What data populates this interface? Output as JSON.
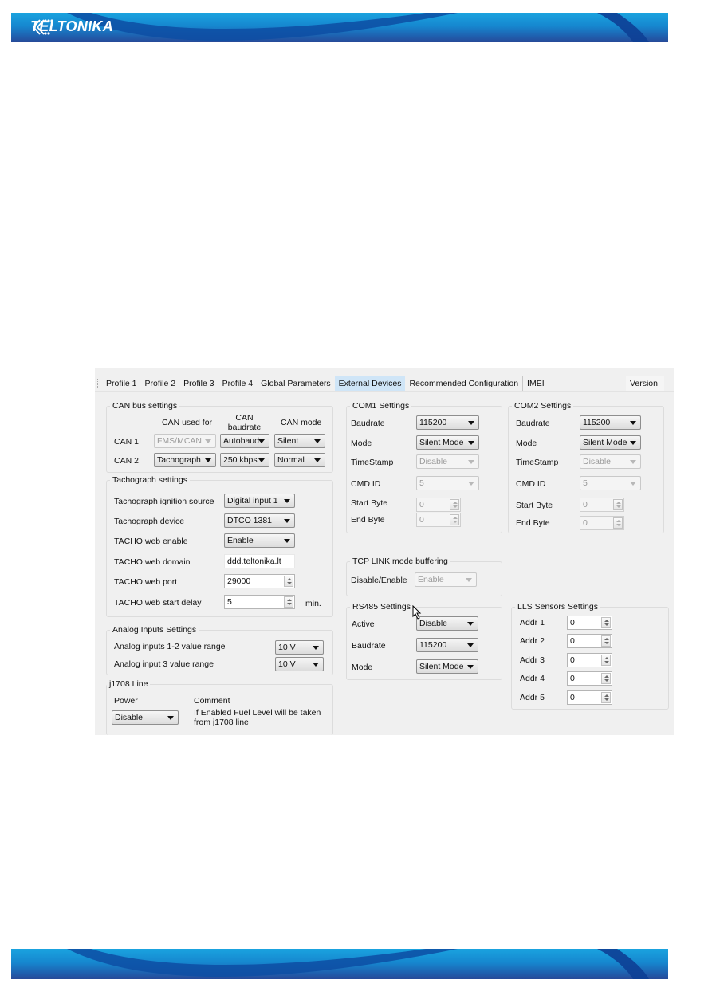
{
  "header": {
    "brand": "TELTONIKA"
  },
  "app": {
    "tabs": [
      {
        "label": "Profile 1"
      },
      {
        "label": "Profile 2"
      },
      {
        "label": "Profile 3"
      },
      {
        "label": "Profile 4"
      },
      {
        "label": "Global Parameters"
      },
      {
        "label": "External Devices",
        "active": true
      },
      {
        "label": "Recommended Configuration"
      },
      {
        "label": "IMEI"
      },
      {
        "label": "Version"
      }
    ],
    "can": {
      "title": "CAN bus settings",
      "col_used_for": "CAN used for",
      "col_baudrate": "CAN baudrate",
      "col_mode": "CAN mode",
      "rows": [
        {
          "label": "CAN 1",
          "used_for": "FMS/MCAN",
          "baudrate": "Autobaud",
          "mode": "Silent"
        },
        {
          "label": "CAN 2",
          "used_for": "Tachograph",
          "baudrate": "250 kbps",
          "mode": "Normal"
        }
      ]
    },
    "tacho": {
      "title": "Tachograph settings",
      "ignition_label": "Tachograph ignition source",
      "ignition_value": "Digital input 1",
      "device_label": "Tachograph device",
      "device_value": "DTCO 1381",
      "web_enable_label": "TACHO web enable",
      "web_enable_value": "Enable",
      "web_domain_label": "TACHO web domain",
      "web_domain_value": "ddd.teltonika.lt",
      "web_port_label": "TACHO web port",
      "web_port_value": "29000",
      "start_delay_label": "TACHO web start delay",
      "start_delay_value": "5",
      "start_delay_unit": "min."
    },
    "analog": {
      "title": "Analog Inputs Settings",
      "in12_label": "Analog inputs 1-2 value range",
      "in12_value": "10 V",
      "in3_label": "Analog input 3 value range",
      "in3_value": "10 V"
    },
    "j1708": {
      "title": "j1708 Line",
      "power_label": "Power",
      "power_value": "Disable",
      "comment_label": "Comment",
      "comment_text_1": "If Enabled Fuel Level will be taken",
      "comment_text_2": "from j1708 line"
    },
    "com1": {
      "title": "COM1 Settings",
      "baudrate_label": "Baudrate",
      "baudrate_value": "115200",
      "mode_label": "Mode",
      "mode_value": "Silent Mode",
      "timestamp_label": "TimeStamp",
      "timestamp_value": "Disable",
      "cmdid_label": "CMD ID",
      "cmdid_value": "5",
      "start_byte_label": "Start Byte",
      "start_byte_value": "0",
      "end_byte_label": "End Byte",
      "end_byte_value": "0"
    },
    "com2": {
      "title": "COM2 Settings",
      "baudrate_label": "Baudrate",
      "baudrate_value": "115200",
      "mode_label": "Mode",
      "mode_value": "Silent Mode",
      "timestamp_label": "TimeStamp",
      "timestamp_value": "Disable",
      "cmdid_label": "CMD ID",
      "cmdid_value": "5",
      "start_byte_label": "Start Byte",
      "start_byte_value": "0",
      "end_byte_label": "End Byte",
      "end_byte_value": "0"
    },
    "tcp": {
      "title": "TCP LINK mode buffering",
      "label": "Disable/Enable",
      "value": "Enable"
    },
    "rs485": {
      "title": "RS485 Settings",
      "active_label": "Active",
      "active_value": "Disable",
      "baudrate_label": "Baudrate",
      "baudrate_value": "115200",
      "mode_label": "Mode",
      "mode_value": "Silent Mode"
    },
    "lls": {
      "title": "LLS Sensors Settings",
      "addrs": [
        {
          "label": "Addr 1",
          "value": "0"
        },
        {
          "label": "Addr 2",
          "value": "0"
        },
        {
          "label": "Addr 3",
          "value": "0"
        },
        {
          "label": "Addr 4",
          "value": "0"
        },
        {
          "label": "Addr 5",
          "value": "0"
        }
      ]
    }
  }
}
